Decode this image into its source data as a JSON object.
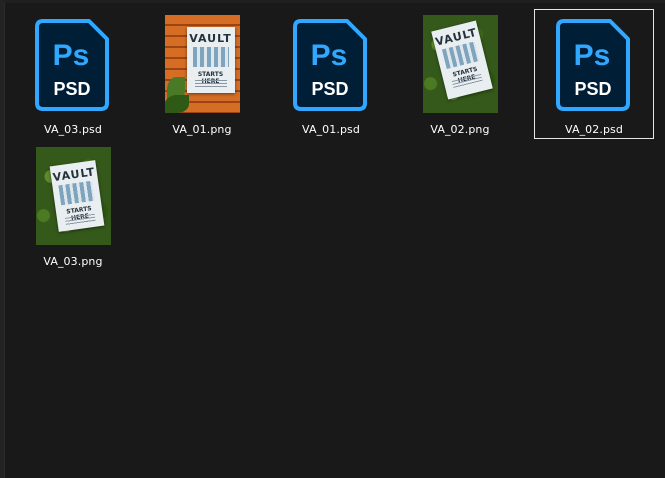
{
  "files": [
    {
      "name": "VA_03.psd",
      "type": "psd",
      "icon": "photoshop-psd-icon",
      "icon_text_top": "Ps",
      "icon_text_bottom": "PSD",
      "selected": false
    },
    {
      "name": "VA_01.png",
      "type": "png",
      "thumbnail": "orange-wall-poster",
      "selected": false
    },
    {
      "name": "VA_01.psd",
      "type": "psd",
      "icon": "photoshop-psd-icon",
      "icon_text_top": "Ps",
      "icon_text_bottom": "PSD",
      "selected": false
    },
    {
      "name": "VA_02.png",
      "type": "png",
      "thumbnail": "grass-poster",
      "selected": false
    },
    {
      "name": "VA_02.psd",
      "type": "psd",
      "icon": "photoshop-psd-icon",
      "icon_text_top": "Ps",
      "icon_text_bottom": "PSD",
      "selected": true
    },
    {
      "name": "VA_03.png",
      "type": "png",
      "thumbnail": "grass-poster",
      "selected": false
    }
  ],
  "poster_text": {
    "title": "VAULT",
    "subtitle": "STARTS HERE"
  },
  "colors": {
    "background": "#191919",
    "psd_icon_fill": "#001e36",
    "psd_icon_accent": "#31a8ff",
    "label_text": "#ffffff",
    "selection_border": "#e6e6e6"
  }
}
